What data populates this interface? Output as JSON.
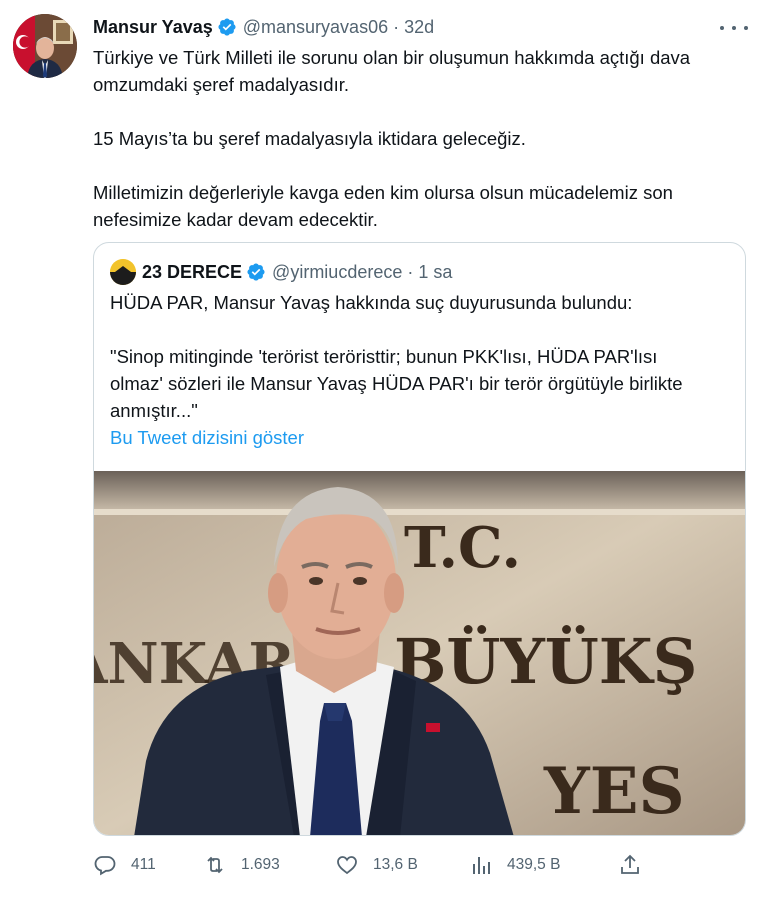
{
  "tweet": {
    "author_name": "Mansur Yavaş",
    "handle": "@mansuryavas06",
    "separator": "·",
    "time": "32d",
    "text_lines": [
      "Türkiye ve Türk Milleti ile sorunu olan bir oluşumun hakkımda açtığı dava",
      "omzumdaki şeref madalyasıdır.",
      "15 Mayıs’ta bu şeref madalyasıyla iktidara geleceğiz.",
      "Milletimizin değerleriyle kavga eden kim olursa olsun mücadelemiz son",
      "nefesimize kadar devam edecektir."
    ]
  },
  "quote": {
    "author_name": "23 DERECE",
    "handle": "@yirmiucderece",
    "separator": "·",
    "time": "1 sa",
    "text_lines": [
      "HÜDA PAR, Mansur Yavaş hakkında suç duyurusunda bulundu:",
      "\"Sinop mitinginde 'terörist teröristtir; bunun PKK'lısı, HÜDA PAR'lısı",
      "olmaz' sözleri ile Mansur Yavaş HÜDA PAR'ı bir terör örgütüyle birlikte",
      "anmıştır...\""
    ],
    "show_thread_label": "Bu Tweet dizisini göster",
    "image_sign_text": {
      "line1": "T.C.",
      "line2_left": "ANKARA",
      "line2_right": "BÜYÜKŞ",
      "line3": "YES"
    }
  },
  "actions": {
    "replies": "411",
    "retweets": "1.693",
    "likes": "13,6 B",
    "views": "439,5 B"
  },
  "colors": {
    "text": "#0f1419",
    "secondary": "#536471",
    "link": "#1d9bf0",
    "verified": "#1d9bf0",
    "border": "#cfd9de"
  },
  "icons": [
    "verified-badge-icon",
    "more-icon",
    "reply-icon",
    "retweet-icon",
    "like-icon",
    "views-icon",
    "share-icon"
  ]
}
